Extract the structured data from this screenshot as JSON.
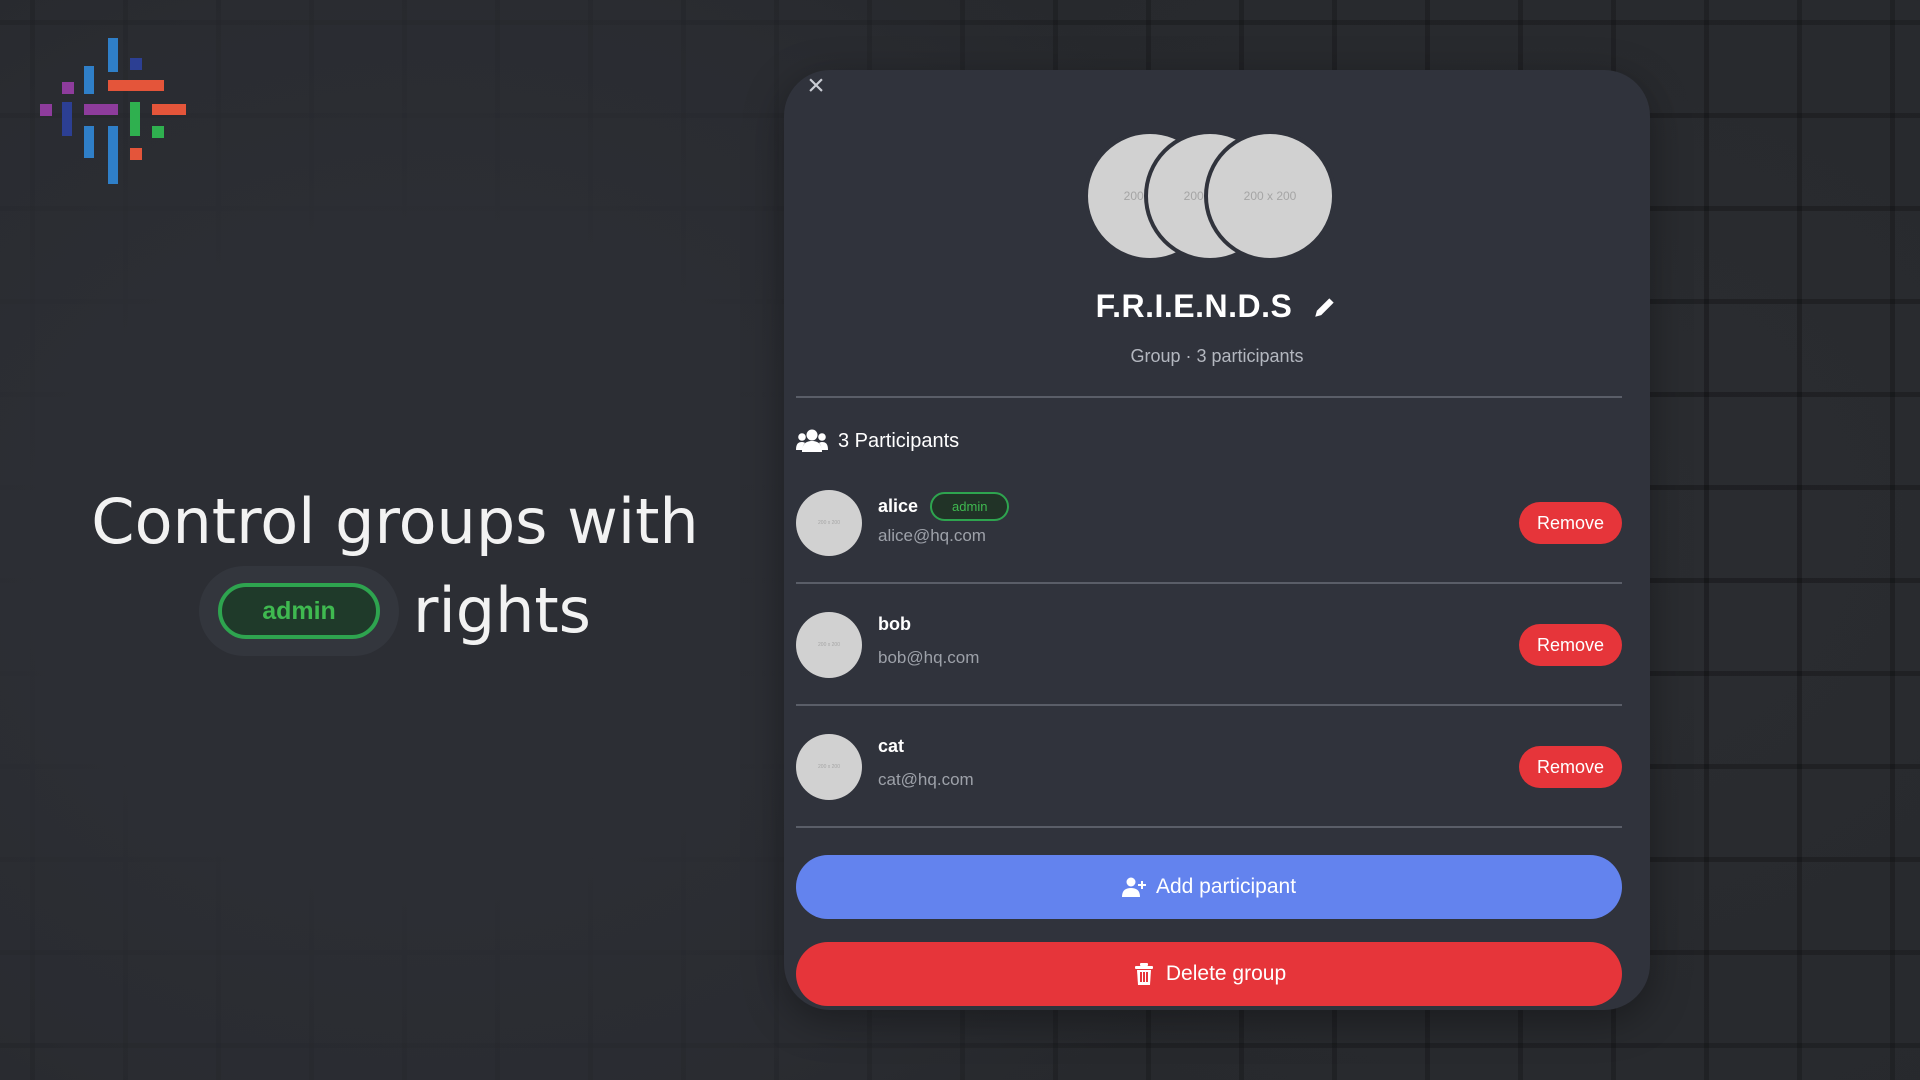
{
  "logo": {
    "colors": {
      "blue": "#2f7fc8",
      "orange": "#e4553a",
      "purple": "#8e3c9c",
      "navy": "#2c3f93",
      "green": "#2fb04f"
    }
  },
  "headline": {
    "line1": "Control groups with",
    "badge": "admin",
    "line2_suffix": "rights"
  },
  "modal": {
    "close_label": "×",
    "avatar_placeholders": [
      "200 x 200",
      "200 x 200",
      "200 x 200"
    ],
    "group_name": "F.R.I.E.N.D.S",
    "group_meta": "Group · 3 participants",
    "participants_heading": "3 Participants",
    "participants": [
      {
        "name": "alice",
        "email": "alice@hq.com",
        "badge": "admin",
        "avatar_placeholder": "200 x 200",
        "remove_label": "Remove"
      },
      {
        "name": "bob",
        "email": "bob@hq.com",
        "badge": "",
        "avatar_placeholder": "200 x 200",
        "remove_label": "Remove"
      },
      {
        "name": "cat",
        "email": "cat@hq.com",
        "badge": "",
        "avatar_placeholder": "200 x 200",
        "remove_label": "Remove"
      }
    ],
    "add_participant_label": "Add participant",
    "delete_group_label": "Delete group"
  },
  "colors": {
    "modal_bg": "#30333c",
    "accent_blue": "#6383ee",
    "danger_red": "#e6353a",
    "admin_green": "#3fb950"
  },
  "icons": {
    "close": "close-icon",
    "edit": "pencil-icon",
    "participants": "users-icon",
    "add": "user-plus-icon",
    "delete": "trash-icon"
  }
}
